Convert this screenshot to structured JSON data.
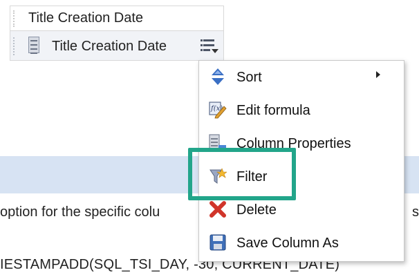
{
  "column_panel": {
    "header_label": "Title Creation Date",
    "item_label": "Title Creation Date"
  },
  "body_text": {
    "line1_left": "option for the specific colu",
    "line1_right": "s p",
    "line2": "IESTAMPADD(SQL_TSI_DAY, -30, CURRENT_DATE)"
  },
  "context_menu": {
    "items": [
      {
        "label": "Sort",
        "icon": "sort-arrows-icon",
        "has_submenu": true
      },
      {
        "label": "Edit formula",
        "icon": "edit-formula-icon",
        "has_submenu": false
      },
      {
        "label": "Column Properties",
        "icon": "column-properties-icon",
        "has_submenu": false
      },
      {
        "label": "Filter",
        "icon": "filter-icon",
        "has_submenu": false
      },
      {
        "label": "Delete",
        "icon": "delete-x-icon",
        "has_submenu": false
      },
      {
        "label": "Save Column As",
        "icon": "save-disk-icon",
        "has_submenu": false
      }
    ]
  },
  "colors": {
    "highlight": "#22a58a",
    "band": "#d7e3f3",
    "delete_red": "#d0352a",
    "sort_blue": "#3a6fc4"
  }
}
